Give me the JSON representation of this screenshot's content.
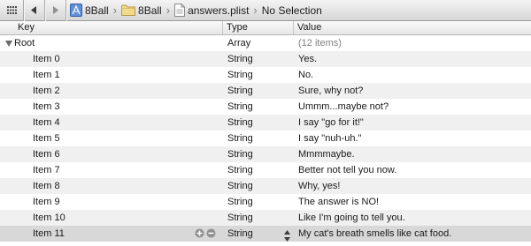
{
  "breadcrumb": {
    "project": "8Ball",
    "group": "8Ball",
    "file": "answers.plist",
    "selection": "No Selection"
  },
  "columns": {
    "key": "Key",
    "type": "Type",
    "value": "Value"
  },
  "root": {
    "key": "Root",
    "type": "Array",
    "value": "(12 items)"
  },
  "items": [
    {
      "key": "Item 0",
      "type": "String",
      "value": "Yes."
    },
    {
      "key": "Item 1",
      "type": "String",
      "value": "No."
    },
    {
      "key": "Item 2",
      "type": "String",
      "value": "Sure, why not?"
    },
    {
      "key": "Item 3",
      "type": "String",
      "value": "Ummm...maybe not?"
    },
    {
      "key": "Item 4",
      "type": "String",
      "value": "I say \"go for it!\""
    },
    {
      "key": "Item 5",
      "type": "String",
      "value": "I say \"nuh-uh.\""
    },
    {
      "key": "Item 6",
      "type": "String",
      "value": "Mmmmaybe."
    },
    {
      "key": "Item 7",
      "type": "String",
      "value": "Better not tell you now."
    },
    {
      "key": "Item 8",
      "type": "String",
      "value": "Why, yes!"
    },
    {
      "key": "Item 9",
      "type": "String",
      "value": "The answer is NO!"
    },
    {
      "key": "Item 10",
      "type": "String",
      "value": "Like I'm going to tell you."
    },
    {
      "key": "Item 11",
      "type": "String",
      "value": "My cat's breath smells like cat food."
    }
  ]
}
